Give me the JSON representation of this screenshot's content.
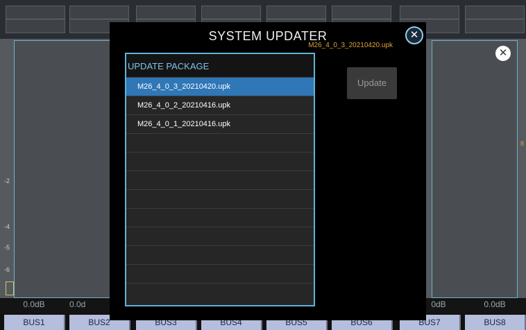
{
  "modal": {
    "title": "SYSTEM UPDATER",
    "current_version": "M26_4_0_3_20210420.upk",
    "close_icon": "close-icon",
    "package_header": "UPDATE PACKAGE",
    "packages": [
      {
        "name": "M26_4_0_3_20210420.upk",
        "selected": true
      },
      {
        "name": "M26_4_0_2_20210416.upk",
        "selected": false
      },
      {
        "name": "M26_4_0_1_20210416.upk",
        "selected": false
      }
    ],
    "update_label": "Update"
  },
  "background": {
    "bus_labels": [
      "BUS1",
      "BUS2",
      "BUS3",
      "BUS4",
      "BUS5",
      "BUS6",
      "BUS7",
      "BUS8"
    ],
    "db_left": [
      "0.0dB",
      "0.0d"
    ],
    "db_right": [
      "0dB",
      "0.0dB"
    ],
    "scale_marks": [
      "-2",
      "-4",
      "-5",
      "-6"
    ],
    "right_mark": "8"
  },
  "colors": {
    "accent": "#5fb4dc",
    "selected_row": "#2f77b6",
    "version_text": "#e0a23a",
    "bus_button": "#b5bedc"
  }
}
